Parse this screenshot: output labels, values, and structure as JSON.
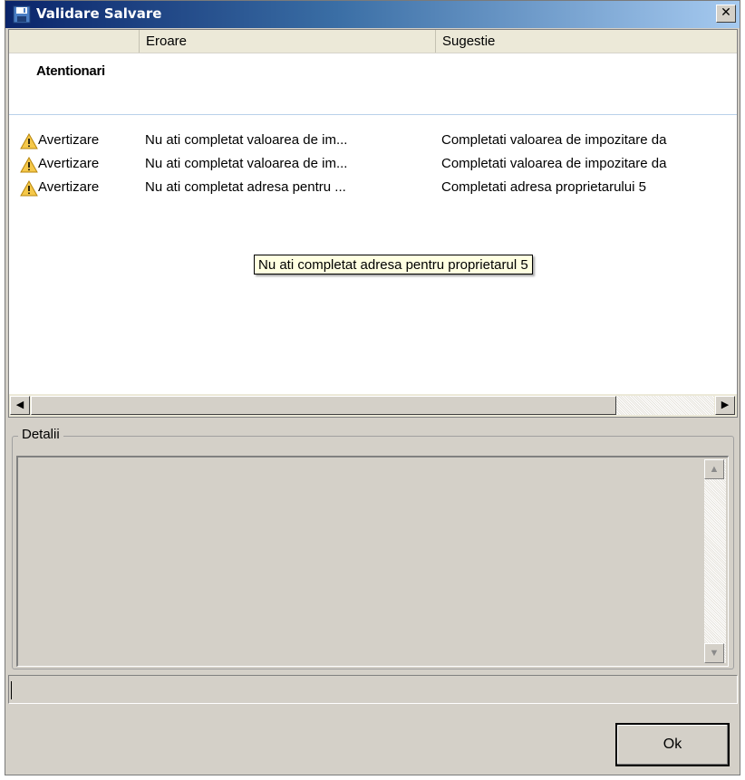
{
  "window": {
    "title": "Validare Salvare",
    "close_glyph": "✕"
  },
  "list": {
    "columns": [
      "",
      "Eroare",
      "Sugestie"
    ],
    "group_label": "Atentionari",
    "rows": [
      {
        "type": "Avertizare",
        "icon": "warning-icon",
        "error": "Nu ati completat valoarea de im...",
        "suggestion": "Completati valoarea de impozitare da"
      },
      {
        "type": "Avertizare",
        "icon": "warning-icon",
        "error": "Nu ati completat valoarea de im...",
        "suggestion": "Completati valoarea de impozitare da"
      },
      {
        "type": "Avertizare",
        "icon": "warning-icon",
        "error": "Nu ati completat adresa pentru ...",
        "suggestion": "Completati adresa proprietarului 5"
      }
    ],
    "tooltip": "Nu ati completat adresa pentru proprietarul  5"
  },
  "details": {
    "legend": "Detalii",
    "text": ""
  },
  "status_text": "",
  "buttons": {
    "ok": "Ok"
  },
  "scroll_glyphs": {
    "left": "◀",
    "right": "▶",
    "up": "▲",
    "down": "▼"
  }
}
